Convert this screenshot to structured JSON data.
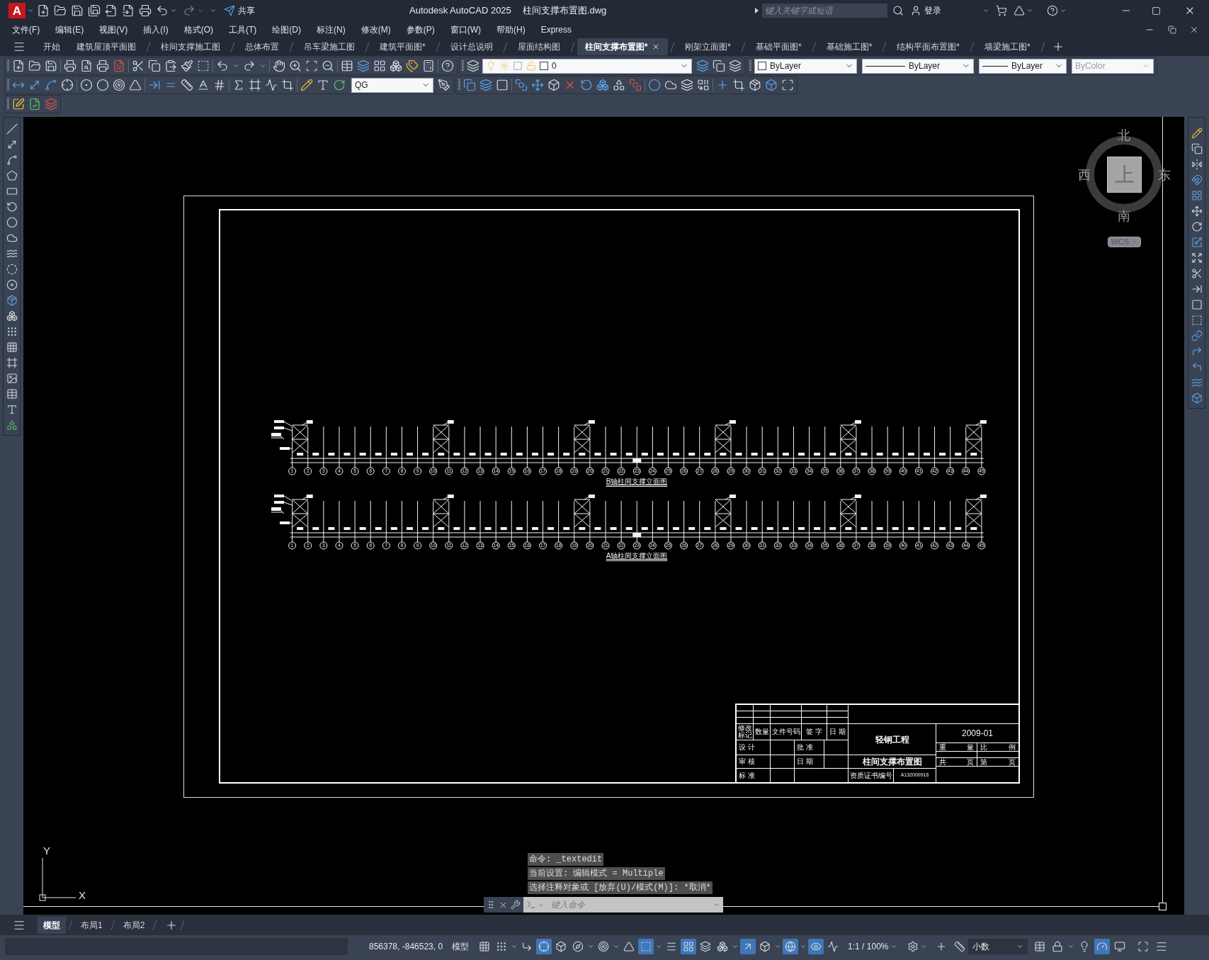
{
  "title_bar": {
    "app_button": "A",
    "redo": {
      "disabled": true
    },
    "share_label": "共享",
    "title": "Autodesk AutoCAD 2025",
    "file_name": "柱间支撑布置图.dwg",
    "search": {
      "placeholder": "键入关键字或短语"
    },
    "sign_in": "登录"
  },
  "menu_bar": [
    "文件(F)",
    "编辑(E)",
    "视图(V)",
    "插入(I)",
    "格式(O)",
    "工具(T)",
    "绘图(D)",
    "标注(N)",
    "修改(M)",
    "参数(P)",
    "窗口(W)",
    "帮助(H)",
    "Express"
  ],
  "file_tabs": [
    {
      "label": "开始",
      "selected": false
    },
    {
      "label": "建筑屋顶平面图",
      "selected": false
    },
    {
      "label": "柱间支撑施工图",
      "selected": false
    },
    {
      "label": "总体布置",
      "selected": false
    },
    {
      "label": "吊车梁施工图",
      "selected": false
    },
    {
      "label": "建筑平面图*",
      "selected": false
    },
    {
      "label": "设计总说明",
      "selected": false
    },
    {
      "label": "屋面结构图",
      "selected": false
    },
    {
      "label": "柱间支撑布置图*",
      "selected": true
    },
    {
      "label": "刚架立面图*",
      "selected": false
    },
    {
      "label": "基础平面图*",
      "selected": false
    },
    {
      "label": "基础施工图*",
      "selected": false
    },
    {
      "label": "结构平面布置图*",
      "selected": false
    },
    {
      "label": "墙梁施工图*",
      "selected": false
    }
  ],
  "properties_toolbar": {
    "layer": "0",
    "object_color": "ByLayer",
    "linetype": "ByLayer",
    "lineweight": "ByLayer",
    "plot_style": {
      "value": "ByColor",
      "disabled": true
    }
  },
  "dimension_toolbar": {
    "dim_style": "QG"
  },
  "viewcube": {
    "north": "北",
    "west": "西",
    "east": "东",
    "south": "南",
    "face": "上",
    "ucs": "WCS"
  },
  "drawing": {
    "elevations": [
      {
        "title": "B轴柱间支撑立面图",
        "axis_labels": [
          "1",
          "2",
          "3",
          "4",
          "5",
          "6",
          "7",
          "8",
          "9",
          "10",
          "11",
          "12",
          "13",
          "14",
          "15",
          "16",
          "17",
          "18",
          "19",
          "20",
          "21",
          "22",
          "23",
          "24",
          "25",
          "26",
          "27",
          "28",
          "29",
          "30",
          "31",
          "32",
          "33",
          "34",
          "35",
          "36",
          "37",
          "38",
          "39",
          "40",
          "41",
          "42",
          "43",
          "44",
          "45"
        ]
      },
      {
        "title": "A轴柱间支撑立面图",
        "axis_labels": [
          "1",
          "2",
          "3",
          "4",
          "5",
          "6",
          "7",
          "8",
          "9",
          "10",
          "11",
          "12",
          "13",
          "14",
          "15",
          "16",
          "17",
          "18",
          "19",
          "20",
          "21",
          "22",
          "23",
          "24",
          "25",
          "26",
          "27",
          "28",
          "29",
          "30",
          "31",
          "32",
          "33",
          "34",
          "35",
          "36",
          "37",
          "38",
          "39",
          "40",
          "41",
          "42",
          "43",
          "44",
          "45"
        ]
      }
    ],
    "title_block": {
      "revision_headers": [
        "修改标记",
        "数量",
        "文件号码",
        "签 字",
        "日 期"
      ],
      "designed": "设 计",
      "approved": "批 准",
      "checked": "审 核",
      "date_label": "日 期",
      "standard": "标 准",
      "project": "轻钢工程",
      "drawing_title": "柱间支撑布置图",
      "cert_label": "资质证书编号",
      "cert_no": "A132000916",
      "date": "2009-01",
      "weight": "重 量",
      "scale": "比 例",
      "sheets_total": "共 页",
      "sheet_no": "第 页"
    }
  },
  "ucs_icon": {
    "x": "X",
    "y": "Y"
  },
  "command_history": [
    "命令: _textedit",
    "当前设置: 编辑模式 = Multiple",
    "选择注释对象或 [放弃(U)/模式(M)]: *取消*"
  ],
  "command_line": {
    "placeholder": "键入命令"
  },
  "layout_tabs": [
    {
      "label": "模型",
      "selected": true
    },
    {
      "label": "布局1",
      "selected": false
    },
    {
      "label": "布局2",
      "selected": false
    }
  ],
  "status_bar": {
    "coordinates": "856378, -846523, 0",
    "space": "模型",
    "left_toggles": [
      {
        "on": false
      },
      {
        "on": false
      },
      {
        "on": false
      },
      {
        "on": true
      },
      {
        "on": false
      },
      {
        "on": false
      },
      {
        "on": false
      },
      {
        "on": false
      },
      {
        "on": true
      },
      {
        "on": false
      },
      {
        "on": true
      },
      {
        "on": false
      },
      {
        "on": false
      },
      {
        "on": true
      },
      {
        "on": false
      },
      {
        "on": true
      },
      {
        "on": true
      },
      {
        "on": false
      }
    ],
    "annotation_scale": "1:1 / 100%",
    "units": "小数",
    "right_toggles": [
      {
        "on": false
      },
      {
        "on": false
      },
      {
        "on": false
      },
      {
        "on": true
      },
      {
        "on": false
      }
    ]
  }
}
